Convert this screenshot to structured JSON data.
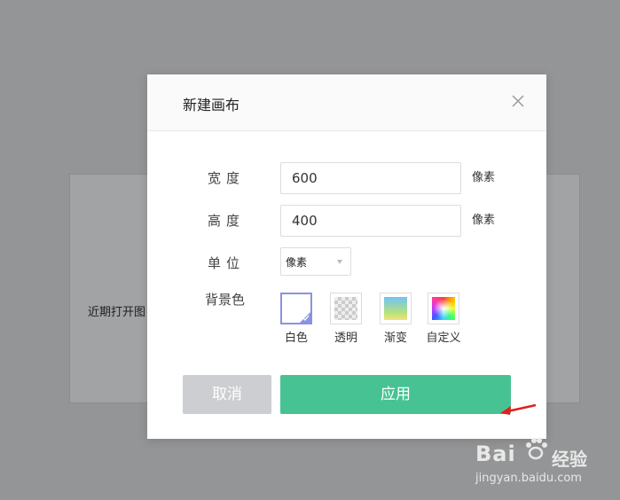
{
  "background": {
    "recent_label": "近期打开图"
  },
  "dialog": {
    "title": "新建画布",
    "close_icon": "close-icon",
    "fields": {
      "width": {
        "label": "宽度",
        "value": "600",
        "unit": "像素"
      },
      "height": {
        "label": "高度",
        "value": "400",
        "unit": "像素"
      },
      "unit": {
        "label": "单位",
        "selected": "像素"
      },
      "background": {
        "label": "背景色",
        "options": [
          {
            "label": "白色",
            "selected": true
          },
          {
            "label": "透明",
            "selected": false
          },
          {
            "label": "渐变",
            "selected": false
          },
          {
            "label": "自定义",
            "selected": false
          }
        ]
      }
    },
    "buttons": {
      "cancel": "取消",
      "apply": "应用"
    }
  },
  "colors": {
    "apply": "#47c393",
    "cancel": "#ccced1",
    "selected_border": "#8b92e0",
    "annotation_arrow": "#e02020"
  },
  "watermark": {
    "logo": "Bai",
    "logo_suffix": "经验",
    "url": "jingyan.baidu.com"
  }
}
